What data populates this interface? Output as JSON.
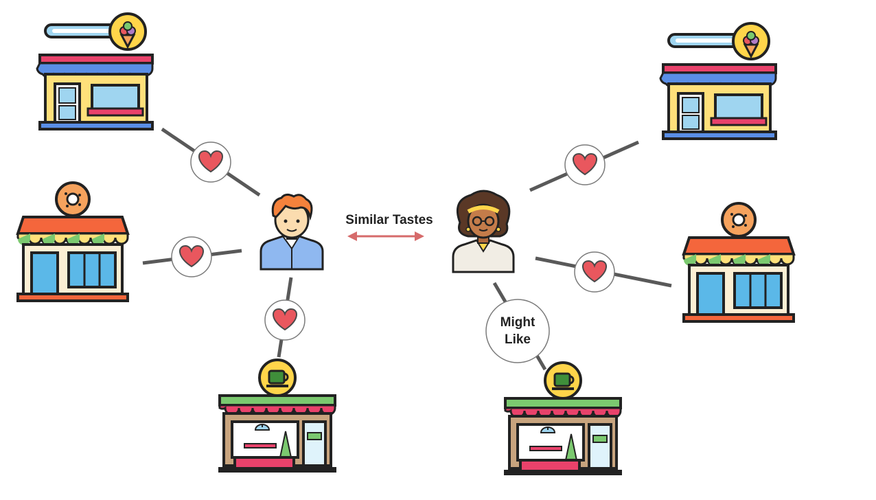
{
  "diagram": {
    "similar_label": "Similar Tastes",
    "might_like_line1": "Might",
    "might_like_line2": "Like",
    "colors": {
      "connector": "#595959",
      "heart": "#e9575e",
      "arrow": "#d66b6b",
      "outline": "#222222"
    },
    "icons": {
      "user_a": "boy-avatar-icon",
      "user_b": "woman-avatar-icon",
      "shop_ice_cream": "ice-cream-shop-icon",
      "shop_donut": "donut-shop-icon",
      "shop_cafe": "coffee-shop-icon",
      "like": "heart-icon"
    }
  }
}
